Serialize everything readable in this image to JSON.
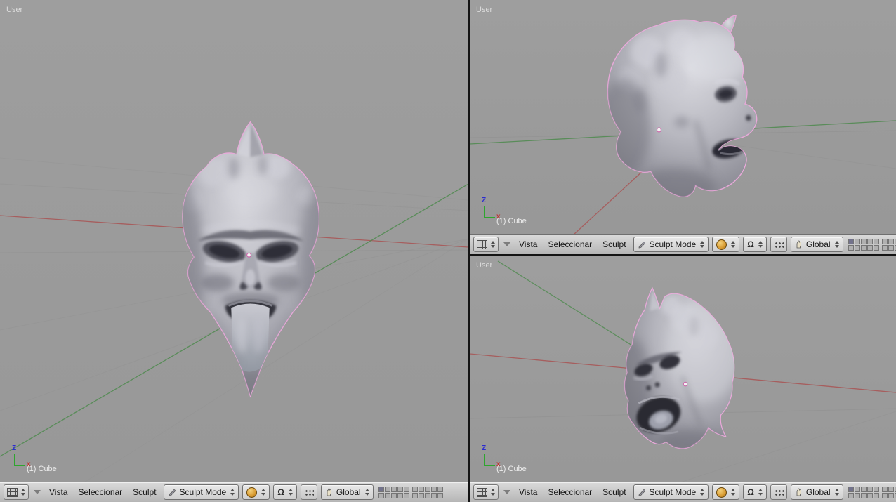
{
  "view": {
    "view_label": "User",
    "object_label": "(1) Cube",
    "axis_z": "Z",
    "axis_x": "x"
  },
  "header": {
    "menus": [
      {
        "label": "Vista"
      },
      {
        "label": "Seleccionar"
      },
      {
        "label": "Sculpt"
      }
    ],
    "mode_combo": {
      "value": "Sculpt Mode",
      "icon": "sculpt-brush-icon"
    },
    "shading_combo": {
      "icon": "shaded-sphere-icon"
    },
    "pivot_combo": {
      "glyph": "Ω",
      "icon": "pivot-omega-icon"
    },
    "manipulator_toggle": {
      "icon": "manipulator-dots-icon"
    },
    "orientation_combo": {
      "value": "Global",
      "icon": "pan-hand-icon"
    },
    "editor_type": {
      "icon": "grid-editor-icon"
    },
    "layers": {
      "blocks": 2,
      "rows": 2,
      "cols": 5,
      "active_index": 0
    }
  },
  "colors": {
    "viewport_bg": "#9b9b9b",
    "header_bg": "#c9c9c9",
    "axis_line_green": "#2fa52f",
    "axis_z_label": "#2b2bd0",
    "axis_x_label": "#c23030",
    "grid_red_line": "#a85858",
    "grid_green_line": "#4e8a4e",
    "selection_outline": "#e9a9da",
    "sphere_icon_color": "#d89a30"
  }
}
